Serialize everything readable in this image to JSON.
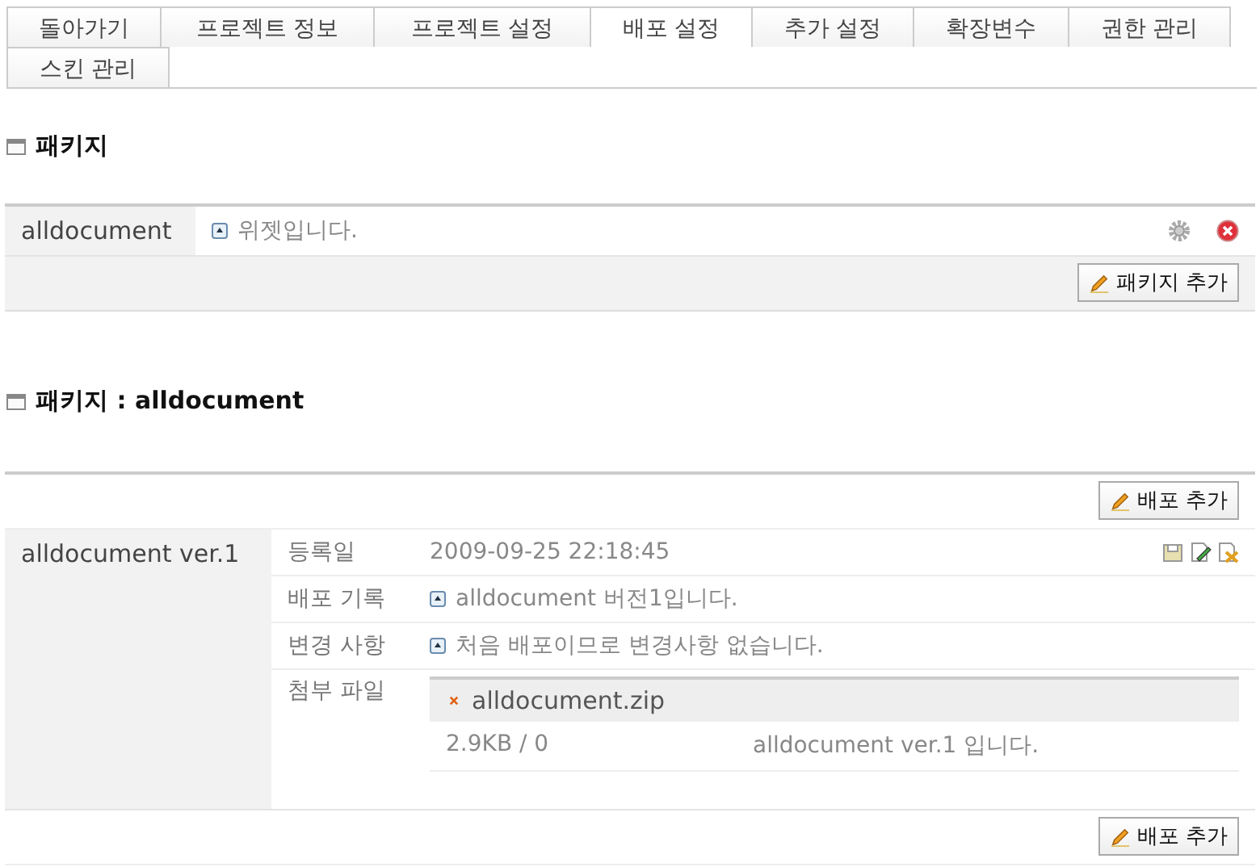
{
  "tabs": [
    {
      "label": "돌아가기",
      "selected": false
    },
    {
      "label": "프로젝트 정보",
      "selected": false
    },
    {
      "label": "프로젝트 설정",
      "selected": false
    },
    {
      "label": "배포 설정",
      "selected": true
    },
    {
      "label": "추가 설정",
      "selected": false
    },
    {
      "label": "확장변수",
      "selected": false
    },
    {
      "label": "권한 관리",
      "selected": false
    },
    {
      "label": "스킨 관리",
      "selected": false
    }
  ],
  "packages": {
    "title": "패키지",
    "items": [
      {
        "name": "alldocument",
        "description": "위젯입니다."
      }
    ],
    "add_button": "패키지 추가"
  },
  "releases": {
    "title": "패키지 : alldocument",
    "add_button_top": "배포 추가",
    "add_button_bottom": "배포 추가",
    "items": [
      {
        "version": "alldocument ver.1",
        "fields": [
          {
            "kind": "date",
            "label": "등록일",
            "value": "2009-09-25 22:18:45"
          },
          {
            "kind": "text",
            "label": "배포 기록",
            "value": "alldocument 버전1입니다."
          },
          {
            "kind": "text",
            "label": "변경 사항",
            "value": "처음 배포이므로 변경사항 없습니다."
          },
          {
            "kind": "files",
            "label": "첨부 파일",
            "files": [
              {
                "name": "alldocument.zip",
                "size": "2.9KB / 0",
                "description": "alldocument ver.1 입니다."
              }
            ]
          }
        ]
      }
    ]
  }
}
